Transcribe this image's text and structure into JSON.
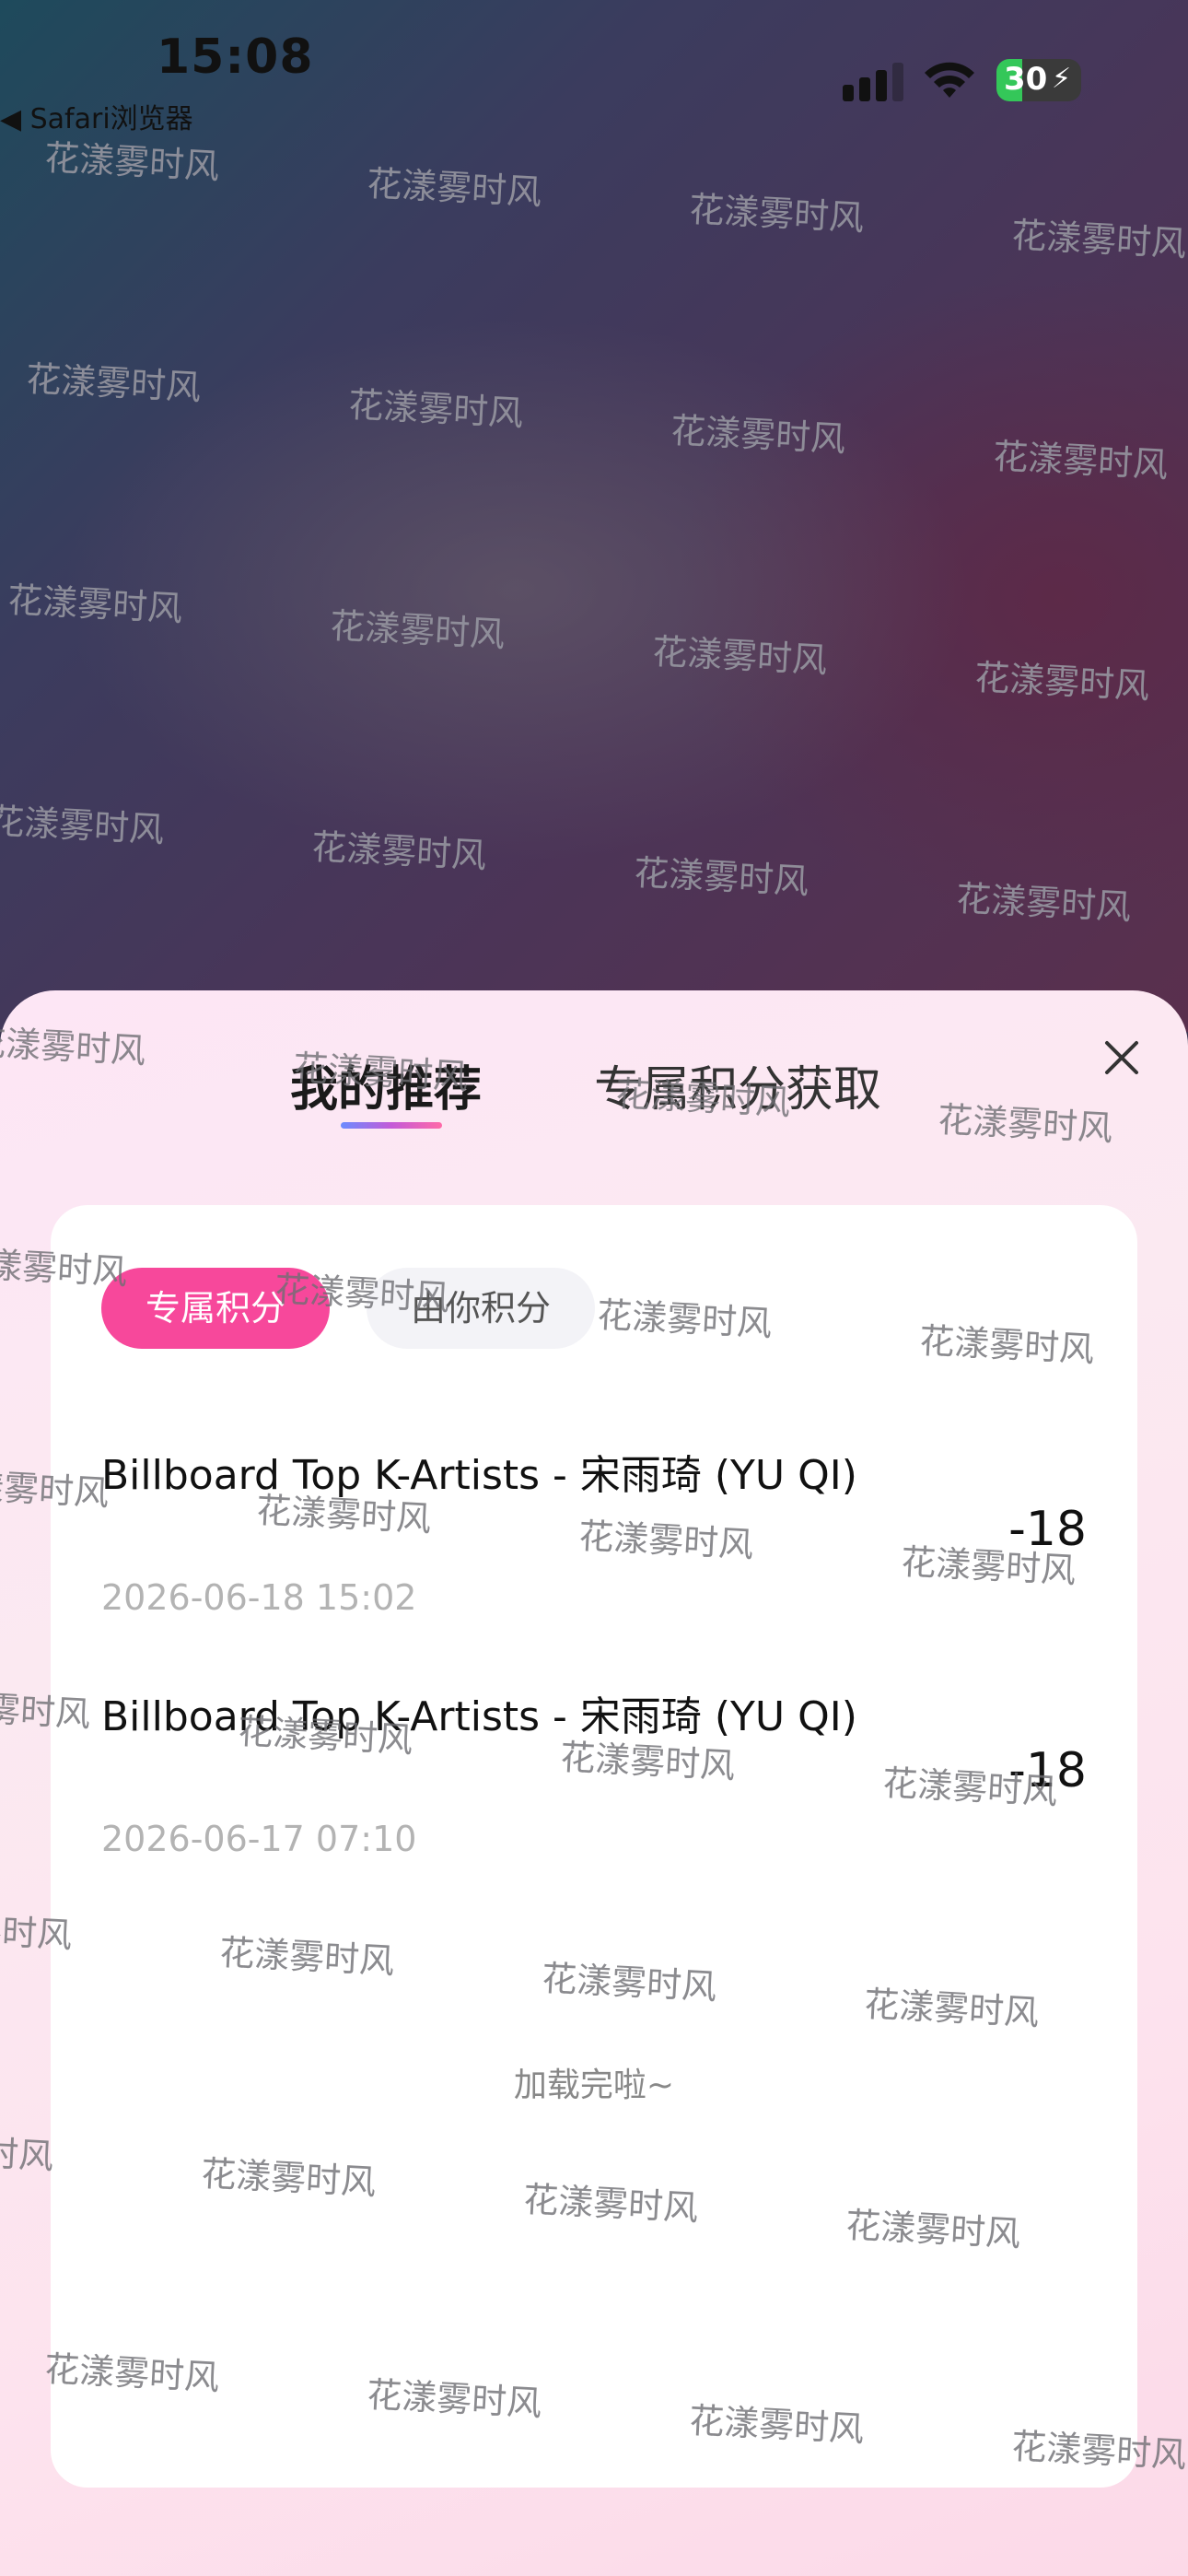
{
  "status_bar": {
    "time": "15:08",
    "back_app": "◀ Safari浏览器",
    "battery": "30"
  },
  "sheet": {
    "tabs": [
      {
        "label": "我的推荐",
        "active": true
      },
      {
        "label": "专属积分获取",
        "active": false
      }
    ],
    "close_icon": "close-icon"
  },
  "filters": [
    {
      "label": "专属积分",
      "active": true
    },
    {
      "label": "由你积分",
      "active": false
    }
  ],
  "records": [
    {
      "title": "Billboard Top K-Artists - 宋雨琦 (YU QI)",
      "date": "2026-06-18 15:02",
      "amount": "-18"
    },
    {
      "title": "Billboard Top K-Artists - 宋雨琦 (YU QI)",
      "date": "2026-06-17 07:10",
      "amount": "-18"
    }
  ],
  "loaded_text": "加载完啦~",
  "watermark": "花漾雾时风",
  "colors": {
    "accent_pink": "#f7489b",
    "battery_green": "#34c759"
  }
}
